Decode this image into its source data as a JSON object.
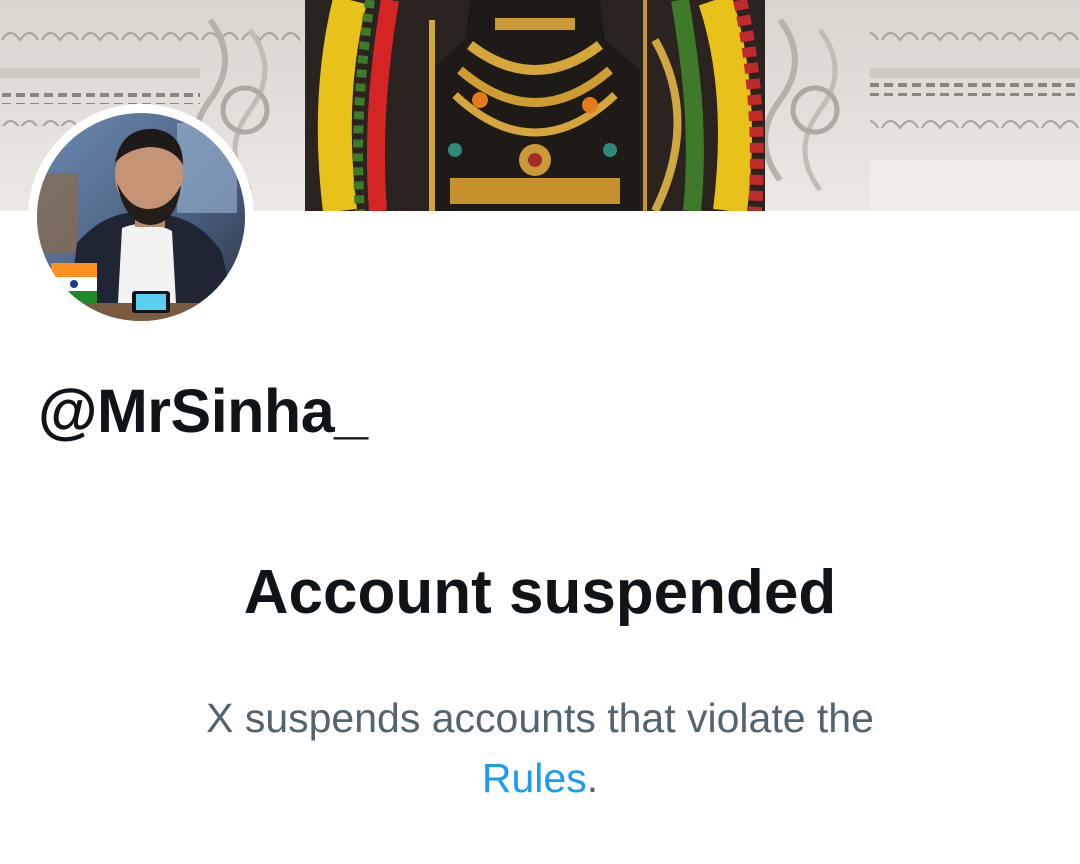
{
  "profile": {
    "handle": "@MrSinha_"
  },
  "status": {
    "title": "Account suspended",
    "description": "X suspends accounts that violate the",
    "link_label": "Rules",
    "trailing": "."
  },
  "colors": {
    "primary_text": "#0f1419",
    "secondary_text": "#536471",
    "link": "#1d9bf0",
    "background": "#ffffff"
  },
  "images": {
    "banner": "temple-deity-banner-photo",
    "avatar": "profile-photo"
  }
}
